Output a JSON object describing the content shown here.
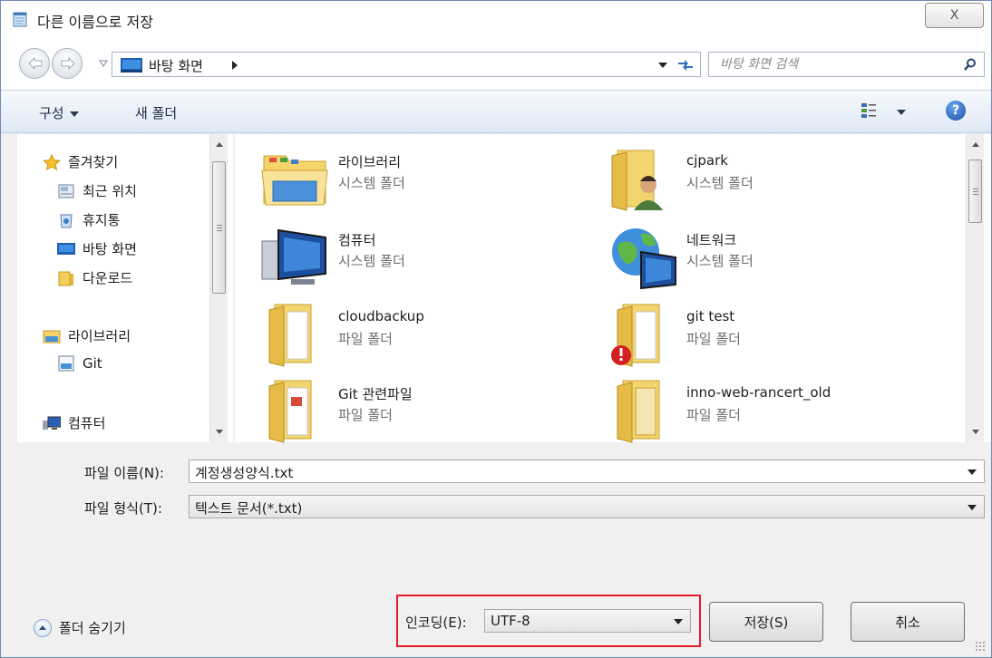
{
  "window": {
    "title": "다른 이름으로 저장",
    "close_label": "X"
  },
  "address_bar": {
    "location": "바탕 화면",
    "search_placeholder": "바탕 화면 검색"
  },
  "toolbar": {
    "organize_label": "구성",
    "new_folder_label": "새 폴더",
    "help_label": "?"
  },
  "navigation": {
    "favorites_label": "즐겨찾기",
    "favorites_items": [
      {
        "label": "최근 위치",
        "icon": "recent-places-icon"
      },
      {
        "label": "휴지통",
        "icon": "recycle-bin-icon"
      },
      {
        "label": "바탕 화면",
        "icon": "desktop-icon"
      },
      {
        "label": "다운로드",
        "icon": "downloads-folder-icon"
      }
    ],
    "libraries_label": "라이브러리",
    "libraries_items": [
      {
        "label": "Git",
        "icon": "git-library-icon"
      }
    ],
    "computer_label": "컴퓨터"
  },
  "files": [
    {
      "name": "라이브러리",
      "type": "시스템 폴더",
      "icon": "libraries-folder-icon"
    },
    {
      "name": "cjpark",
      "type": "시스템 폴더",
      "icon": "user-folder-icon"
    },
    {
      "name": "컴퓨터",
      "type": "시스템 폴더",
      "icon": "computer-icon"
    },
    {
      "name": "네트워크",
      "type": "시스템 폴더",
      "icon": "network-icon"
    },
    {
      "name": "cloudbackup",
      "type": "파일 폴더",
      "icon": "folder-icon"
    },
    {
      "name": "git test",
      "type": "파일 폴더",
      "icon": "folder-warning-icon"
    },
    {
      "name": "Git 관련파일",
      "type": "파일 폴더",
      "icon": "folder-icon"
    },
    {
      "name": "inno-web-rancert_old",
      "type": "파일 폴더",
      "icon": "folder-icon"
    }
  ],
  "form": {
    "filename_label": "파일 이름(N):",
    "filename_value": "계정생성양식.txt",
    "filetype_label": "파일 형식(T):",
    "filetype_value": "텍스트 문서(*.txt)",
    "hide_folders_label": "폴더 숨기기",
    "encoding_label": "인코딩(E):",
    "encoding_value": "UTF-8",
    "save_label": "저장(S)",
    "cancel_label": "취소"
  },
  "colors": {
    "highlight_border": "#e8192c",
    "toolbar_top": "#f6f9fd",
    "toolbar_bottom": "#dfe9f5"
  }
}
